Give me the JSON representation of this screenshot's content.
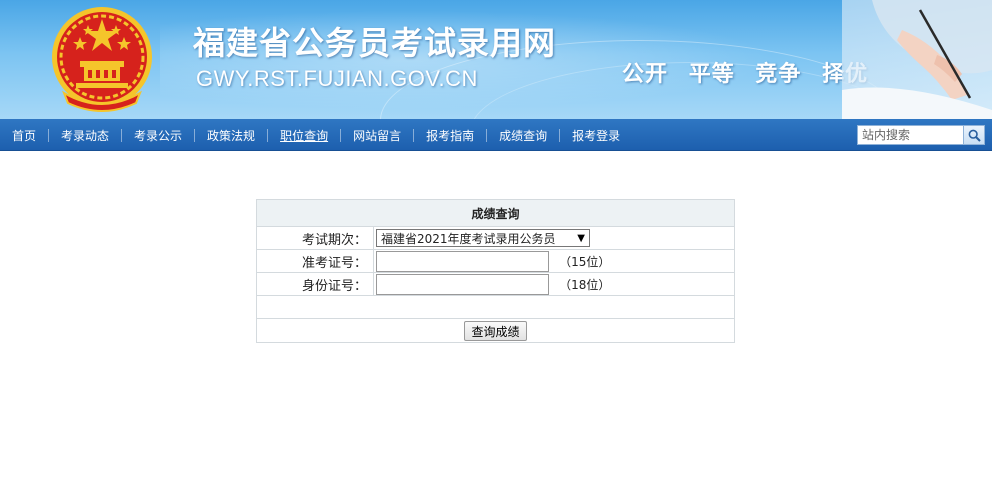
{
  "header": {
    "site_title": "福建省公务员考试录用网",
    "site_domain": "GWY.RST.FUJIAN.GOV.CN",
    "slogan": [
      "公开",
      "平等",
      "竞争",
      "择优"
    ],
    "emblem_icon": "national-emblem-icon",
    "colors": {
      "banner_top": "#4aa6e6",
      "banner_bottom": "#a6d8f7",
      "emblem_red": "#d6221c",
      "emblem_gold": "#f5c52b"
    }
  },
  "nav": {
    "items": [
      {
        "label": "首页"
      },
      {
        "label": "考录动态"
      },
      {
        "label": "考录公示"
      },
      {
        "label": "政策法规"
      },
      {
        "label": "职位查询"
      },
      {
        "label": "网站留言"
      },
      {
        "label": "报考指南"
      },
      {
        "label": "成绩查询"
      },
      {
        "label": "报考登录"
      }
    ],
    "search_placeholder": "站内搜索",
    "search_icon": "search-icon",
    "colors": {
      "bar": "#2268b5"
    }
  },
  "form": {
    "title": "成绩查询",
    "exam_label": "考试期次：",
    "exam_selected": "福建省2021年度考试录用公务员",
    "ticket_label": "准考证号：",
    "ticket_value": "",
    "ticket_hint": "（15位）",
    "id_label": "身份证号：",
    "id_value": "",
    "id_hint": "（18位）",
    "submit_label": "查询成绩"
  }
}
